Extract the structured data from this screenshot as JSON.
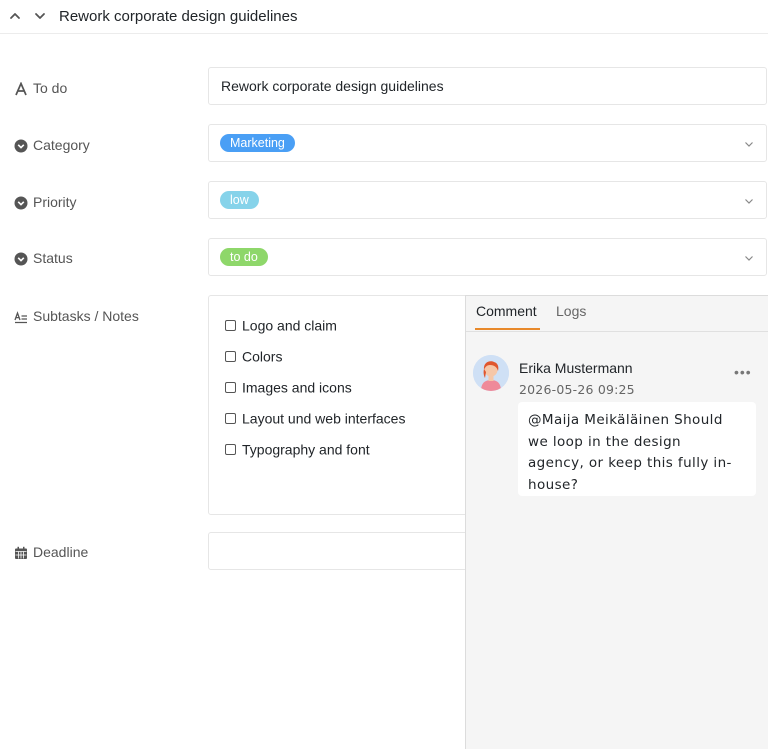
{
  "header": {
    "title": "Rework corporate design guidelines"
  },
  "fields": {
    "todo": {
      "label": "To do",
      "value": "Rework corporate design guidelines"
    },
    "category": {
      "label": "Category",
      "value": "Marketing",
      "color": "#4a9ff5"
    },
    "priority": {
      "label": "Priority",
      "value": "low",
      "color": "#86d3ea"
    },
    "status": {
      "label": "Status",
      "value": "to do",
      "color": "#8ed76a"
    },
    "subtasks": {
      "label": "Subtasks / Notes",
      "items": [
        "Logo and claim",
        "Colors",
        "Images and icons",
        "Layout und web interfaces",
        "Typography and font"
      ]
    },
    "deadline": {
      "label": "Deadline",
      "value": ""
    }
  },
  "comments": {
    "tabs": [
      "Comment",
      "Logs"
    ],
    "active_tab": "Comment",
    "entries": [
      {
        "author": "Erika Mustermann",
        "time": "2026-05-26 09:25",
        "text_lines": [
          "@Maija Meikäläinen Should",
          "we loop in the design",
          "agency, or keep this fully in-",
          "house?"
        ]
      }
    ]
  },
  "colors": {
    "accent": "#e8892b"
  }
}
